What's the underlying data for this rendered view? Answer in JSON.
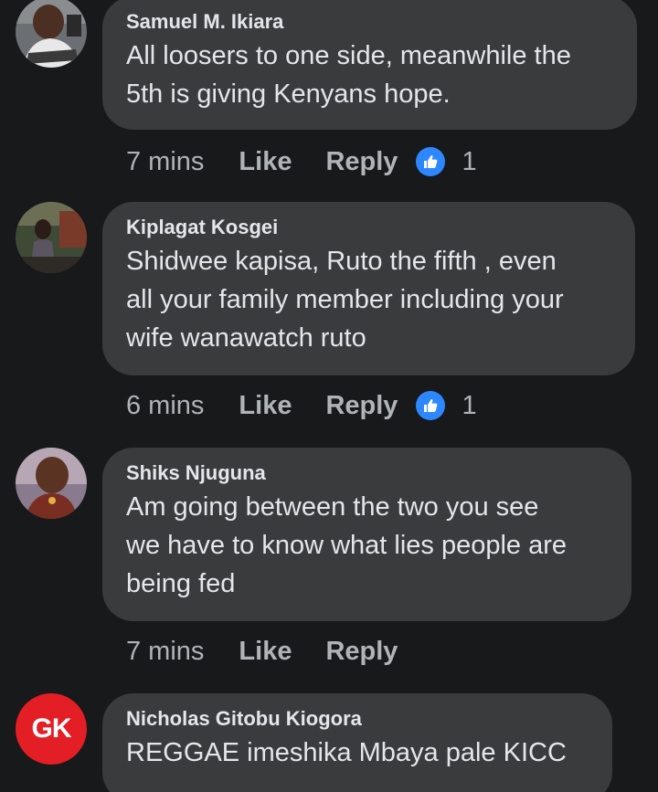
{
  "comments": [
    {
      "author": "Samuel M. Ikiara",
      "lines": [
        "All loosers to one side, meanwhile the",
        "5th is giving Kenyans hope."
      ],
      "time": "7 mins",
      "like_label": "Like",
      "reply_label": "Reply",
      "reaction_count": "1"
    },
    {
      "author": "Kiplagat Kosgei",
      "lines": [
        "Shidwee kapisa, Ruto the fifth , even",
        "all your family member including your",
        "wife  wanawatch ruto"
      ],
      "time": "6 mins",
      "like_label": "Like",
      "reply_label": "Reply",
      "reaction_count": "1"
    },
    {
      "author": "Shiks Njuguna",
      "lines": [
        "Am going between the two you see",
        "we have to know what lies people are",
        "being fed"
      ],
      "time": "7 mins",
      "like_label": "Like",
      "reply_label": "Reply"
    },
    {
      "author": "Nicholas Gitobu Kiogora",
      "avatar_initials": "GK",
      "lines": [
        "REGGAE imeshika Mbaya pale KICC"
      ]
    }
  ],
  "colors": {
    "background": "#18191a",
    "bubble": "#3a3b3c",
    "text": "#e4e6eb",
    "secondary_text": "#b0b3b8",
    "like_blue": "#2d88ff",
    "gk_red": "#e41e25"
  },
  "icons": {
    "reaction": "thumbs-up-icon"
  }
}
